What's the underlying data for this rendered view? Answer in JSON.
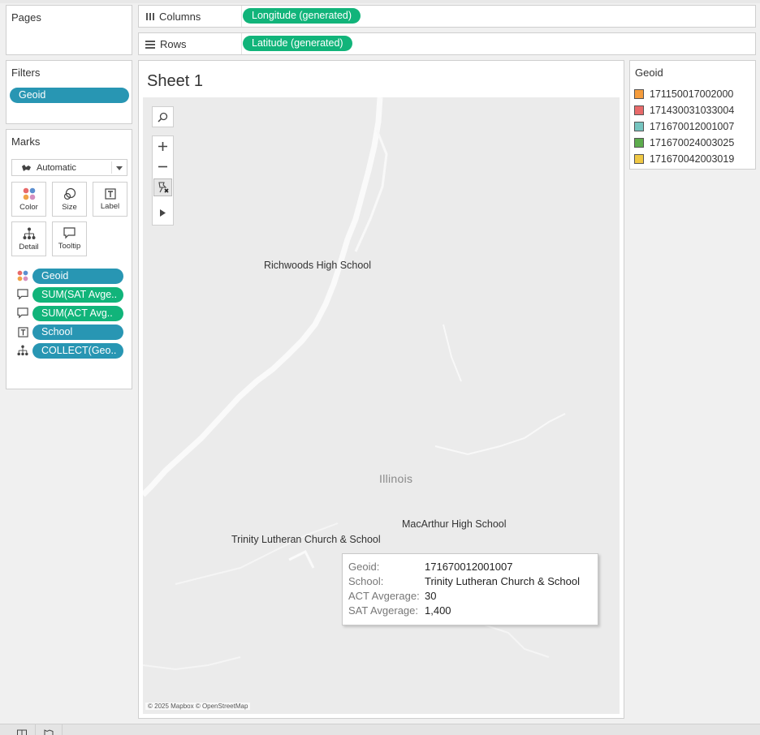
{
  "pages": {
    "title": "Pages"
  },
  "columns": {
    "label": "Columns",
    "pill": "Longitude (generated)"
  },
  "rows": {
    "label": "Rows",
    "pill": "Latitude (generated)"
  },
  "filters": {
    "title": "Filters",
    "pills": [
      "Geoid"
    ]
  },
  "marks": {
    "title": "Marks",
    "type_label": "Automatic",
    "cards": [
      {
        "label": "Color",
        "icon": "color-icon"
      },
      {
        "label": "Size",
        "icon": "size-icon"
      },
      {
        "label": "Label",
        "icon": "label-icon"
      },
      {
        "label": "Detail",
        "icon": "detail-icon"
      },
      {
        "label": "Tooltip",
        "icon": "tooltip-icon"
      }
    ],
    "fields": [
      {
        "label": "Geoid",
        "icon": "color-icon",
        "color": "#2896b3"
      },
      {
        "label": "SUM(SAT Avge..",
        "icon": "tooltip-icon",
        "color": "#11b47a"
      },
      {
        "label": "SUM(ACT Avg..",
        "icon": "tooltip-icon",
        "color": "#11b47a"
      },
      {
        "label": "School",
        "icon": "label-icon",
        "color": "#2896b3"
      },
      {
        "label": "COLLECT(Geo..",
        "icon": "detail-icon",
        "color": "#2896b3"
      }
    ]
  },
  "sheet": {
    "title": "Sheet 1"
  },
  "map": {
    "state_label": "Illinois",
    "schools": [
      "Richwoods High School",
      "MacArthur High School",
      "Trinity Lutheran Church & School"
    ],
    "attribution": "© 2025 Mapbox © OpenStreetMap"
  },
  "legend": {
    "title": "Geoid",
    "items": [
      {
        "label": "171150017002000",
        "color": "#f59c3c"
      },
      {
        "label": "171430031033004",
        "color": "#e86a6a"
      },
      {
        "label": "171670012001007",
        "color": "#76c5c0"
      },
      {
        "label": "171670024003025",
        "color": "#5dac4d"
      },
      {
        "label": "171670042003019",
        "color": "#f0c844"
      }
    ]
  },
  "tooltip": {
    "rows": [
      {
        "key": "Geoid:",
        "value": "171670012001007"
      },
      {
        "key": "School:",
        "value": "Trinity Lutheran Church & School"
      },
      {
        "key": "ACT Avgerage:",
        "value": "30"
      },
      {
        "key": "SAT Avgerage:",
        "value": "1,400"
      }
    ]
  }
}
